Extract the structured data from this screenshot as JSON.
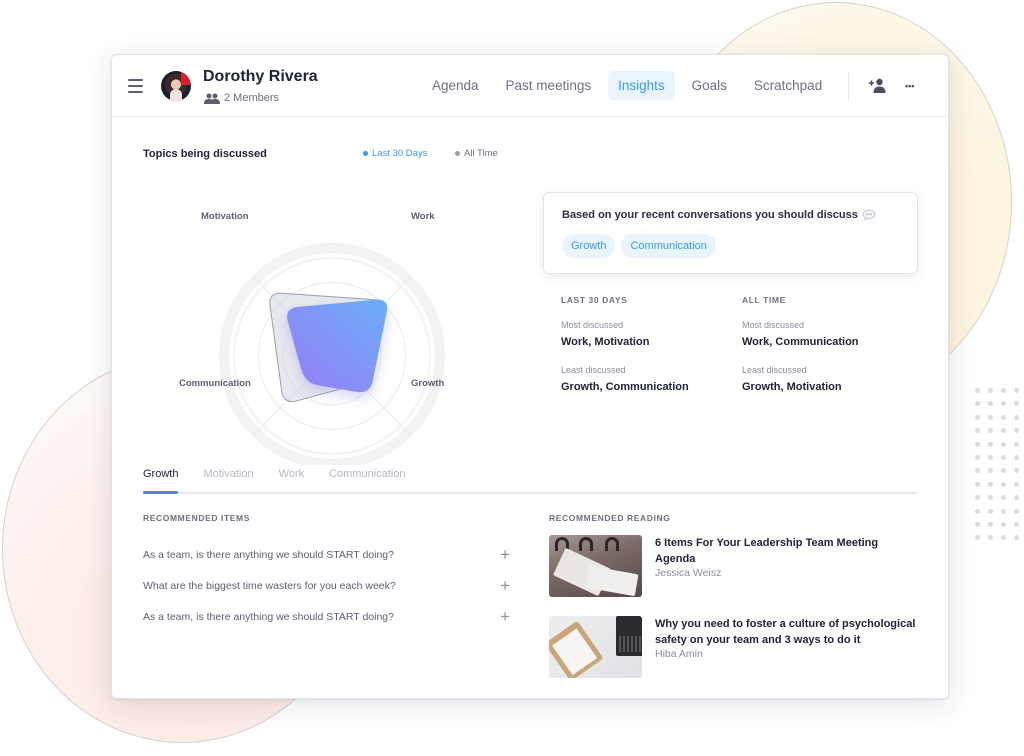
{
  "header": {
    "title": "Dorothy Rivera",
    "members": "2 Members",
    "nav": [
      {
        "label": "Agenda",
        "active": false
      },
      {
        "label": "Past meetings",
        "active": false
      },
      {
        "label": "Insights",
        "active": true
      },
      {
        "label": "Goals",
        "active": false
      },
      {
        "label": "Scratchpad",
        "active": false
      }
    ],
    "more_glyph": "•••"
  },
  "topics": {
    "title": "Topics being discussed",
    "legend": [
      {
        "label": "Last 30 Days",
        "color": "#3a9bea"
      },
      {
        "label": "All Time",
        "color": "#9a9dab"
      }
    ]
  },
  "chart_data": {
    "type": "radar",
    "axes": [
      "Work",
      "Growth",
      "Communication",
      "Motivation"
    ],
    "range": [
      0,
      100
    ],
    "rings": 4,
    "series": [
      {
        "name": "All Time",
        "values": [
          80,
          40,
          70,
          92
        ],
        "color": "#9a9dab"
      },
      {
        "name": "Last 30 Days",
        "values": [
          83,
          55,
          39,
          69
        ],
        "color_from": "#6aa9f7",
        "color_to": "#9b7ef6"
      }
    ]
  },
  "suggestion": {
    "text": "Based on your recent conversations you should discuss",
    "chips": [
      "Growth",
      "Communication"
    ]
  },
  "stats": {
    "last30": {
      "heading": "LAST 30 DAYS",
      "most_label": "Most discussed",
      "most_value": "Work, Motivation",
      "least_label": "Least discussed",
      "least_value": "Growth, Communication"
    },
    "alltime": {
      "heading": "ALL TIME",
      "most_label": "Most discussed",
      "most_value": "Work, Communication",
      "least_label": "Least discussed",
      "least_value": "Growth, Motivation"
    }
  },
  "tabs": [
    {
      "label": "Growth",
      "active": true
    },
    {
      "label": "Motivation",
      "active": false
    },
    {
      "label": "Work",
      "active": false
    },
    {
      "label": "Communication",
      "active": false
    }
  ],
  "recommended_items": {
    "heading": "RECOMMENDED ITEMS",
    "items": [
      "As a team, is there anything we should START doing?",
      "What are the biggest time wasters for you each week?",
      "As a team, is there anything we should START doing?"
    ],
    "add_glyph": "+"
  },
  "recommended_reading": {
    "heading": "RECOMMENDED READING",
    "articles": [
      {
        "title": "6 Items For Your Leadership Team Meeting Agenda",
        "author": "Jessica Weisz"
      },
      {
        "title": "Why you need to foster a culture of psychological safety on your team and 3 ways to do it",
        "author": "Hiba Amin"
      }
    ]
  }
}
